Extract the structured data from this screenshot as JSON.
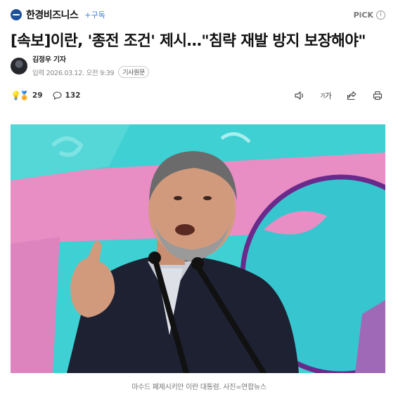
{
  "press": {
    "name": "한경비즈니스",
    "subscribe_label": "+구독",
    "pick_label": "PiCK",
    "info_icon": "info-icon",
    "logo_color": "#1d4f9b"
  },
  "article": {
    "headline": "[속보]이란, '종전 조건' 제시…\"침략 재발 방지 보장해야\"",
    "reporter": "김정우 기자",
    "date_prefix": "입력",
    "date": "2026.03.12. 오전 9:39",
    "original_label": "기사원문",
    "photo_caption": "마수드 페제시키안 이란 대통령. 사진=연합뉴스"
  },
  "toolbar": {
    "reaction_count": "29",
    "comment_count": "132",
    "font_label_small": "가",
    "font_label_big": "가",
    "icons": [
      "bulb-icon",
      "medal-icon",
      "comment-icon",
      "speaker-icon",
      "font-size-icon",
      "share-icon",
      "print-icon"
    ]
  },
  "colors": {
    "accent": "#3c7ce3",
    "photo_teal": "#3ed0d2",
    "photo_pink": "#e88ec4"
  }
}
